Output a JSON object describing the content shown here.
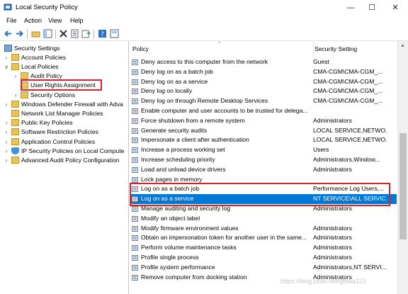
{
  "window": {
    "title": "Local Security Policy"
  },
  "menu": [
    "File",
    "Action",
    "View",
    "Help"
  ],
  "toolbar_icons": [
    "back-icon",
    "forward-icon",
    "up-folder-icon",
    "show-hide-tree-icon",
    "delete-icon",
    "properties-icon",
    "export-list-icon",
    "help-icon",
    "view-icon"
  ],
  "tree": [
    {
      "label": "Security Settings",
      "expand": "",
      "indent": 0,
      "icon": "security-settings"
    },
    {
      "label": "Account Policies",
      "expand": ">",
      "indent": 1,
      "icon": "folder"
    },
    {
      "label": "Local Policies",
      "expand": "v",
      "indent": 1,
      "icon": "folder"
    },
    {
      "label": "Audit Policy",
      "expand": ">",
      "indent": 2,
      "icon": "folder"
    },
    {
      "label": "User Rights Assignment",
      "expand": "",
      "indent": 2,
      "icon": "folder"
    },
    {
      "label": "Security Options",
      "expand": ">",
      "indent": 2,
      "icon": "folder"
    },
    {
      "label": "Windows Defender Firewall with Adva",
      "expand": ">",
      "indent": 1,
      "icon": "folder"
    },
    {
      "label": "Network List Manager Policies",
      "expand": "",
      "indent": 1,
      "icon": "folder"
    },
    {
      "label": "Public Key Policies",
      "expand": ">",
      "indent": 1,
      "icon": "folder"
    },
    {
      "label": "Software Restriction Policies",
      "expand": ">",
      "indent": 1,
      "icon": "folder"
    },
    {
      "label": "Application Control Policies",
      "expand": ">",
      "indent": 1,
      "icon": "folder"
    },
    {
      "label": "IP Security Policies on Local Compute",
      "expand": ">",
      "indent": 1,
      "icon": "shield"
    },
    {
      "label": "Advanced Audit Policy Configuration",
      "expand": ">",
      "indent": 1,
      "icon": "folder"
    }
  ],
  "columns": {
    "policy": "Policy",
    "setting": "Security Setting"
  },
  "rows": [
    {
      "policy": "Deny access to this computer from the network",
      "setting": "Guest"
    },
    {
      "policy": "Deny log on as a batch job",
      "setting": "CMA-CGM\\CMA-CGM_..."
    },
    {
      "policy": "Deny log on as a service",
      "setting": "CMA-CGM\\CMA-CGM_..."
    },
    {
      "policy": "Deny log on locally",
      "setting": "CMA-CGM\\CMA-CGM_..."
    },
    {
      "policy": "Deny log on through Remote Desktop Services",
      "setting": "CMA-CGM\\CMA-CGM_..."
    },
    {
      "policy": "Enable computer and user accounts to be trusted for delega...",
      "setting": ""
    },
    {
      "policy": "Force shutdown from a remote system",
      "setting": "Administrators"
    },
    {
      "policy": "Generate security audits",
      "setting": "LOCAL SERVICE,NETWO..."
    },
    {
      "policy": "Impersonate a client after authentication",
      "setting": "LOCAL SERVICE,NETWO..."
    },
    {
      "policy": "Increase a process working set",
      "setting": "Users"
    },
    {
      "policy": "Increase scheduling priority",
      "setting": "Administrators,Window..."
    },
    {
      "policy": "Load and unload device drivers",
      "setting": "Administrators"
    },
    {
      "policy": "Lock pages in memory",
      "setting": ""
    },
    {
      "policy": "Log on as a batch job",
      "setting": "Performance Log Users,..."
    },
    {
      "policy": "Log on as a service",
      "setting": "NT SERVICE\\ALL SERVIC..."
    },
    {
      "policy": "Manage auditing and security log",
      "setting": "Administrators"
    },
    {
      "policy": "Modify an object label",
      "setting": ""
    },
    {
      "policy": "Modify firmware environment values",
      "setting": "Administrators"
    },
    {
      "policy": "Obtain an impersonation token for another user in the same...",
      "setting": "Administrators"
    },
    {
      "policy": "Perform volume maintenance tasks",
      "setting": "Administrators"
    },
    {
      "policy": "Profile single process",
      "setting": "Administrators"
    },
    {
      "policy": "Profile system performance",
      "setting": "Administrators,NT SERVI..."
    },
    {
      "policy": "Remove computer from docking station",
      "setting": "Administrators"
    }
  ],
  "selected_row": "Log on as a service",
  "watermark": "https://blog.csdn.net/gbfaa123",
  "colors": {
    "selection": "#0078d7",
    "highlight_box": "#d9202b",
    "folder": "#e8c25a"
  }
}
